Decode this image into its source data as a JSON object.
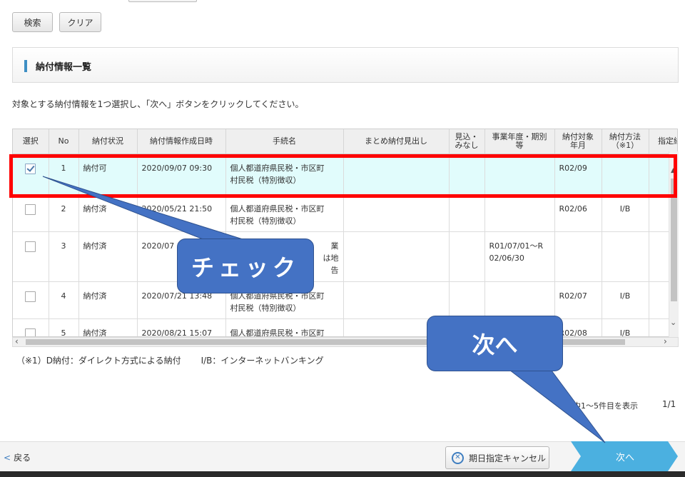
{
  "toolbar": {
    "search_label": "検索",
    "clear_label": "クリア"
  },
  "section": {
    "title": "納付情報一覧"
  },
  "instruction": "対象とする納付情報を1つ選択し、「次へ」ボタンをクリックしてください。",
  "table": {
    "headers": {
      "select": "選択",
      "no": "No",
      "status": "納付状況",
      "created": "納付情報作成日時",
      "procedure": "手続名",
      "summary": "まとめ納付見出し",
      "deemed_1": "見込・",
      "deemed_2": "みなし",
      "fiscal_1": "事業年度・期別",
      "fiscal_2": "等",
      "target_1": "納付対象",
      "target_2": "年月",
      "method_1": "納付方法",
      "method_2": "（※1）",
      "designated": "指定納"
    },
    "rows": [
      {
        "checked": true,
        "no": "1",
        "status": "納付可",
        "created": "2020/09/07 09:30",
        "procedure_1": "個人都道府県民税・市区町",
        "procedure_2": "村民税（特別徴収）",
        "summary": "",
        "deemed": "",
        "fiscal_1": "",
        "fiscal_2": "",
        "target": "R02/09",
        "method": ""
      },
      {
        "checked": false,
        "no": "2",
        "status": "納付済",
        "created": "2020/05/21 21:50",
        "procedure_1": "個人都道府県民税・市区町",
        "procedure_2": "村民税（特別徴収）",
        "summary": "",
        "deemed": "",
        "fiscal_1": "",
        "fiscal_2": "",
        "target": "R02/06",
        "method": "I/B"
      },
      {
        "checked": false,
        "no": "3",
        "status": "納付済",
        "created": "2020/07",
        "procedure_1": "業",
        "procedure_2": "は地",
        "procedure_3": "告",
        "summary": "",
        "deemed": "",
        "fiscal_1": "R01/07/01〜R",
        "fiscal_2": "02/06/30",
        "target": "",
        "method": ""
      },
      {
        "checked": false,
        "no": "4",
        "status": "納付済",
        "created": "2020/07/21 13:48",
        "procedure_1": "個人都道府県民税・市区町",
        "procedure_2": "村民税（特別徴収）",
        "summary": "",
        "deemed": "",
        "fiscal_1": "",
        "fiscal_2": "",
        "target": "R02/07",
        "method": "I/B"
      },
      {
        "checked": false,
        "no": "5",
        "status": "納付済",
        "created": "2020/08/21 15:07",
        "procedure_1": "個人都道府県民税・市区町",
        "procedure_2": "",
        "summary": "",
        "deemed": "",
        "fiscal_1": "",
        "fiscal_2": "",
        "target": "R02/08",
        "method": "I/B"
      }
    ]
  },
  "note": {
    "dnofu": "（※1）D納付：ダイレクト方式による納付",
    "ib": "I/B：インターネットバンキング"
  },
  "pagination": {
    "summary": "件中1〜5件目を表示",
    "page": "1/1"
  },
  "footer": {
    "back_label": "戻る",
    "cancel_label": "期日指定キャンセル",
    "next_label": "次へ"
  },
  "annotations": {
    "check_callout": "チェック",
    "next_callout": "次へ",
    "highlight_color": "#ff0000",
    "callout_color": "#4472c4"
  }
}
